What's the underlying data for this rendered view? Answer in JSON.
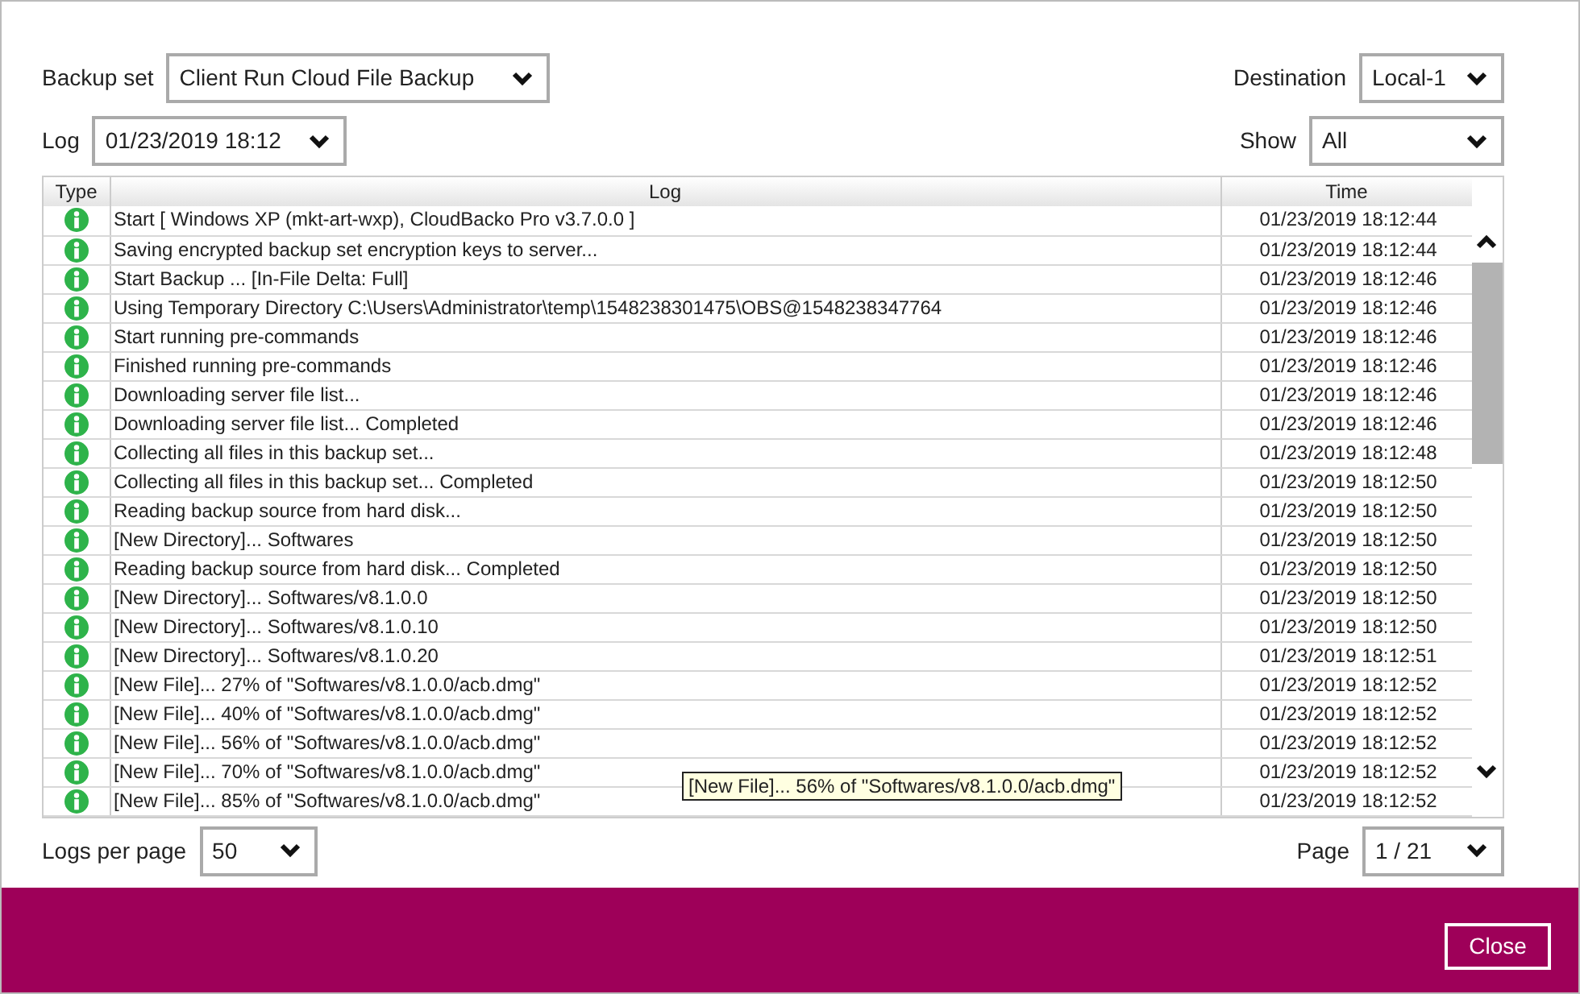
{
  "filters": {
    "backup_set": {
      "label": "Backup set",
      "value": "Client Run Cloud File Backup"
    },
    "destination": {
      "label": "Destination",
      "value": "Local-1"
    },
    "log": {
      "label": "Log",
      "value": "01/23/2019 18:12"
    },
    "show": {
      "label": "Show",
      "value": "All"
    }
  },
  "table": {
    "columns": [
      "Type",
      "Log",
      "Time"
    ],
    "rows": [
      {
        "kind": "info",
        "log": "Start [ Windows XP (mkt-art-wxp), CloudBacko Pro v3.7.0.0 ]",
        "time": "01/23/2019 18:12:44"
      },
      {
        "kind": "info",
        "log": "Saving encrypted backup set encryption keys to server...",
        "time": "01/23/2019 18:12:44"
      },
      {
        "kind": "info",
        "log": "Start Backup ... [In-File Delta: Full]",
        "time": "01/23/2019 18:12:46"
      },
      {
        "kind": "info",
        "log": "Using Temporary Directory C:\\Users\\Administrator\\temp\\1548238301475\\OBS@1548238347764",
        "time": "01/23/2019 18:12:46"
      },
      {
        "kind": "info",
        "log": "Start running pre-commands",
        "time": "01/23/2019 18:12:46"
      },
      {
        "kind": "info",
        "log": "Finished running pre-commands",
        "time": "01/23/2019 18:12:46"
      },
      {
        "kind": "info",
        "log": "Downloading server file list...",
        "time": "01/23/2019 18:12:46"
      },
      {
        "kind": "info",
        "log": "Downloading server file list... Completed",
        "time": "01/23/2019 18:12:46"
      },
      {
        "kind": "info",
        "log": "Collecting all files in this backup set...",
        "time": "01/23/2019 18:12:48"
      },
      {
        "kind": "info",
        "log": "Collecting all files in this backup set... Completed",
        "time": "01/23/2019 18:12:50"
      },
      {
        "kind": "info",
        "log": "Reading backup source from hard disk...",
        "time": "01/23/2019 18:12:50"
      },
      {
        "kind": "info",
        "log": "[New Directory]... Softwares",
        "time": "01/23/2019 18:12:50"
      },
      {
        "kind": "info",
        "log": "Reading backup source from hard disk... Completed",
        "time": "01/23/2019 18:12:50"
      },
      {
        "kind": "info",
        "log": "[New Directory]... Softwares/v8.1.0.0",
        "time": "01/23/2019 18:12:50"
      },
      {
        "kind": "info",
        "log": "[New Directory]... Softwares/v8.1.0.10",
        "time": "01/23/2019 18:12:50"
      },
      {
        "kind": "info",
        "log": "[New Directory]... Softwares/v8.1.0.20",
        "time": "01/23/2019 18:12:51"
      },
      {
        "kind": "info",
        "log": "[New File]... 27% of \"Softwares/v8.1.0.0/acb.dmg\"",
        "time": "01/23/2019 18:12:52"
      },
      {
        "kind": "info",
        "log": "[New File]... 40% of \"Softwares/v8.1.0.0/acb.dmg\"",
        "time": "01/23/2019 18:12:52"
      },
      {
        "kind": "info",
        "log": "[New File]... 56% of \"Softwares/v8.1.0.0/acb.dmg\"",
        "time": "01/23/2019 18:12:52"
      },
      {
        "kind": "info",
        "log": "[New File]... 70% of \"Softwares/v8.1.0.0/acb.dmg\"",
        "time": "01/23/2019 18:12:52"
      },
      {
        "kind": "info",
        "log": "[New File]... 85% of \"Softwares/v8.1.0.0/acb.dmg\"",
        "time": "01/23/2019 18:12:52"
      }
    ]
  },
  "tooltip": "[New File]... 56% of \"Softwares/v8.1.0.0/acb.dmg\"",
  "pager": {
    "per_page": {
      "label": "Logs per page",
      "value": "50"
    },
    "page": {
      "label": "Page",
      "value": "1 / 21"
    }
  },
  "footer": {
    "close_button": "Close"
  }
}
